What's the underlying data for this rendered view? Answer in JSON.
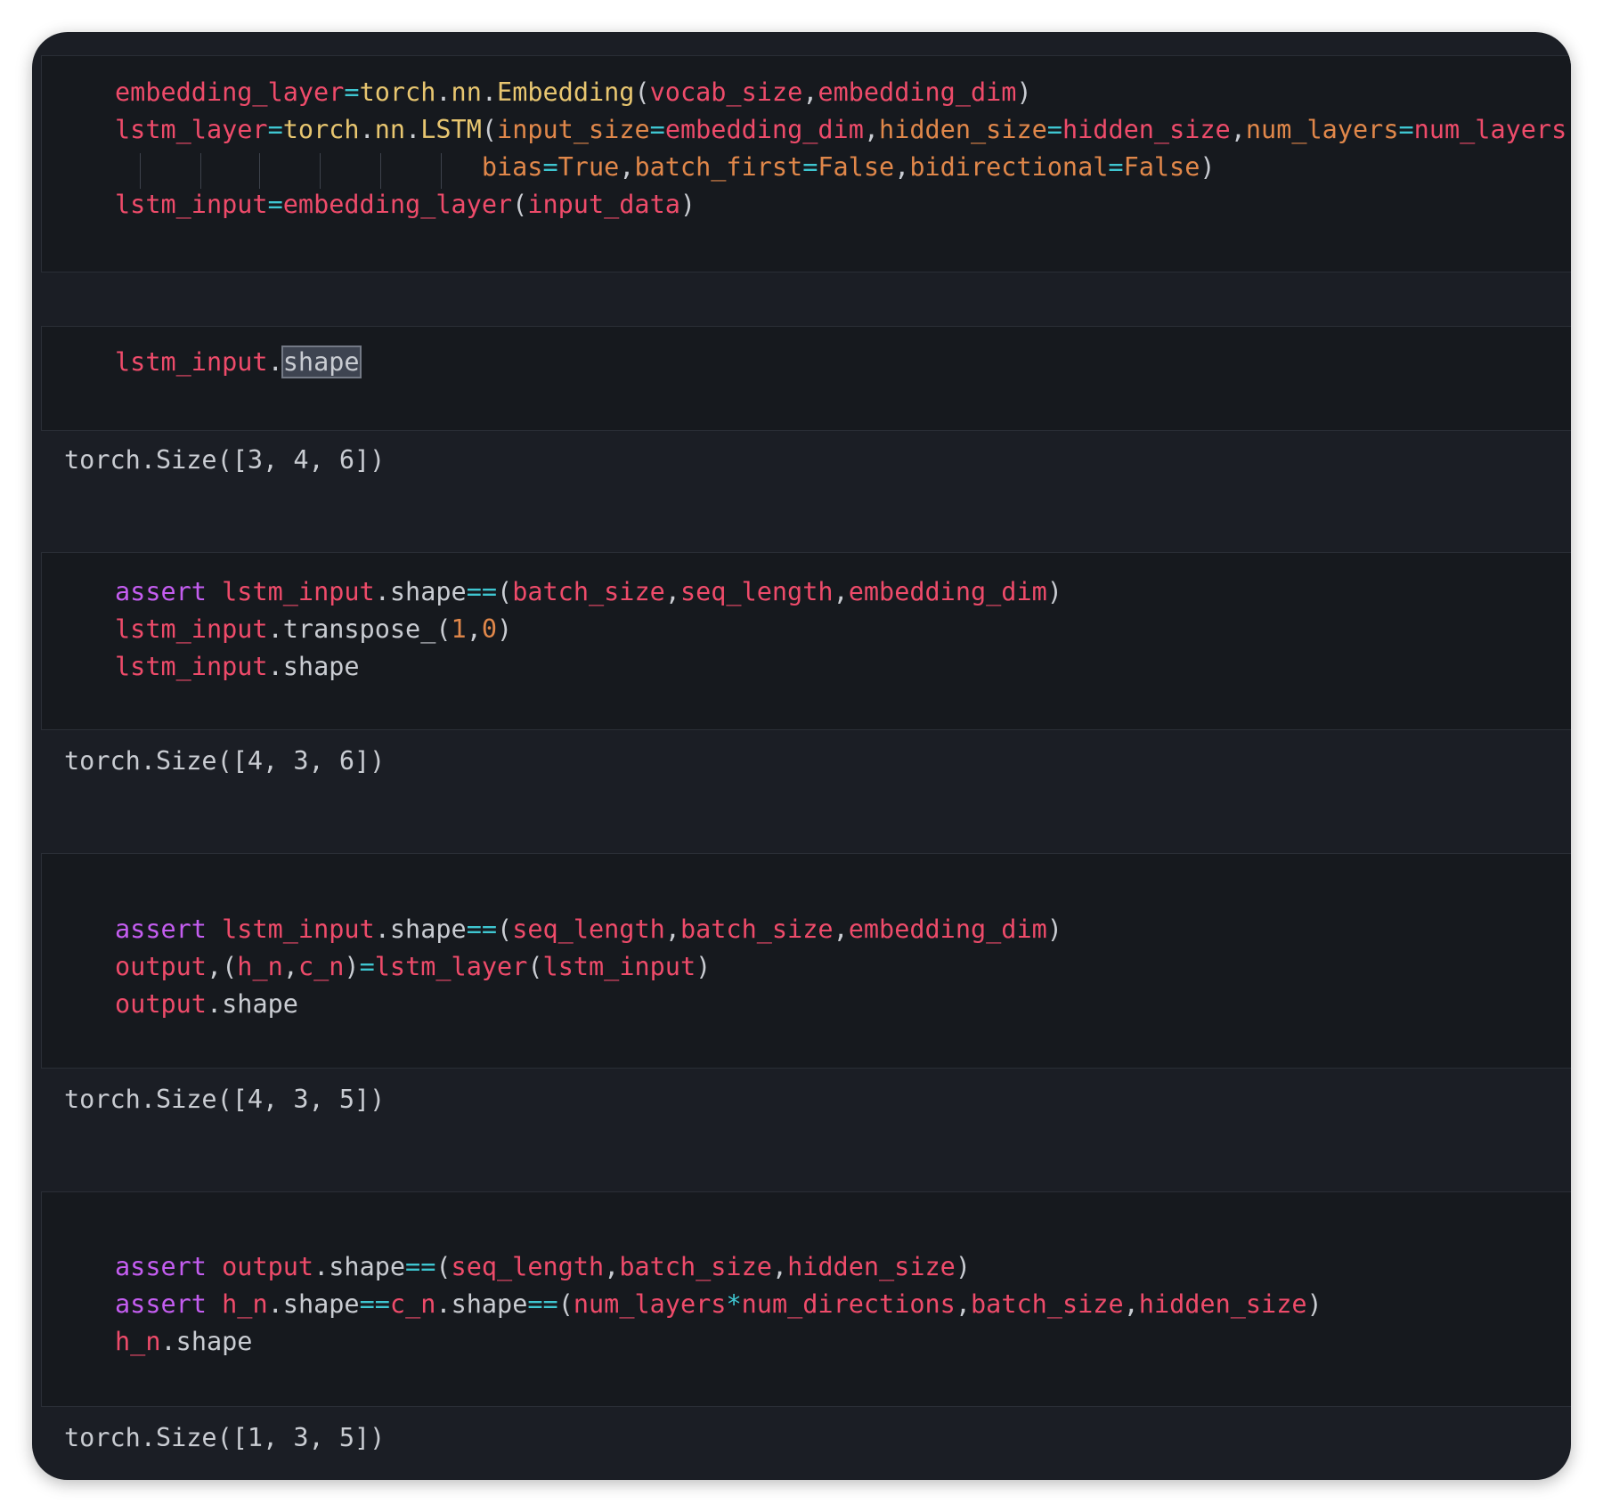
{
  "colors": {
    "background": "#1b1e25",
    "cell_background": "#16191e",
    "variable": "#ee4b6a",
    "keyword": "#c45df0",
    "operator": "#3fc6d1",
    "parameter": "#e0874a",
    "module": "#e8c670",
    "plain": "#c9ccd2",
    "number": "#e0874a"
  },
  "cells": [
    {
      "lines": [
        [
          [
            "embedding_layer",
            "variable"
          ],
          [
            "=",
            "operator"
          ],
          [
            "torch",
            "module"
          ],
          [
            ".",
            "plain"
          ],
          [
            "nn",
            "module"
          ],
          [
            ".",
            "plain"
          ],
          [
            "Embedding",
            "module"
          ],
          [
            "(",
            "plain"
          ],
          [
            "vocab_size",
            "variable"
          ],
          [
            ",",
            "plain"
          ],
          [
            "embedding_dim",
            "variable"
          ],
          [
            ")",
            "plain"
          ]
        ],
        [
          [
            "lstm_layer",
            "variable"
          ],
          [
            "=",
            "operator"
          ],
          [
            "torch",
            "module"
          ],
          [
            ".",
            "plain"
          ],
          [
            "nn",
            "module"
          ],
          [
            ".",
            "plain"
          ],
          [
            "LSTM",
            "module"
          ],
          [
            "(",
            "plain"
          ],
          [
            "input_size",
            "parameter"
          ],
          [
            "=",
            "operator"
          ],
          [
            "embedding_dim",
            "variable"
          ],
          [
            ",",
            "plain"
          ],
          [
            "hidden_size",
            "parameter"
          ],
          [
            "=",
            "operator"
          ],
          [
            "hidden_size",
            "variable"
          ],
          [
            ",",
            "plain"
          ],
          [
            "num_layers",
            "parameter"
          ],
          [
            "=",
            "operator"
          ],
          [
            "num_layers",
            "variable"
          ],
          [
            ",",
            "plain"
          ]
        ],
        [
          [
            "                        ",
            "plain"
          ],
          [
            "bias",
            "parameter"
          ],
          [
            "=",
            "operator"
          ],
          [
            "True",
            "parameter"
          ],
          [
            ",",
            "plain"
          ],
          [
            "batch_first",
            "parameter"
          ],
          [
            "=",
            "operator"
          ],
          [
            "False",
            "parameter"
          ],
          [
            ",",
            "plain"
          ],
          [
            "bidirectional",
            "parameter"
          ],
          [
            "=",
            "operator"
          ],
          [
            "False",
            "parameter"
          ],
          [
            ")",
            "plain"
          ]
        ],
        [
          [
            "lstm_input",
            "variable"
          ],
          [
            "=",
            "operator"
          ],
          [
            "embedding_layer",
            "variable"
          ],
          [
            "(",
            "plain"
          ],
          [
            "input_data",
            "variable"
          ],
          [
            ")",
            "plain"
          ]
        ]
      ],
      "output": ""
    },
    {
      "lines": [
        [
          [
            "lstm_input",
            "variable"
          ],
          [
            ".",
            "plain"
          ],
          [
            "shape",
            "plain"
          ]
        ]
      ],
      "output": "torch.Size([3, 4, 6])"
    },
    {
      "lines": [
        [
          [
            "assert",
            "keyword"
          ],
          [
            " ",
            "plain"
          ],
          [
            "lstm_input",
            "variable"
          ],
          [
            ".",
            "plain"
          ],
          [
            "shape",
            "plain"
          ],
          [
            "==",
            "operator"
          ],
          [
            "(",
            "plain"
          ],
          [
            "batch_size",
            "variable"
          ],
          [
            ",",
            "plain"
          ],
          [
            "seq_length",
            "variable"
          ],
          [
            ",",
            "plain"
          ],
          [
            "embedding_dim",
            "variable"
          ],
          [
            ")",
            "plain"
          ]
        ],
        [
          [
            "lstm_input",
            "variable"
          ],
          [
            ".",
            "plain"
          ],
          [
            "transpose_",
            "plain"
          ],
          [
            "(",
            "plain"
          ],
          [
            "1",
            "number"
          ],
          [
            ",",
            "plain"
          ],
          [
            "0",
            "number"
          ],
          [
            ")",
            "plain"
          ]
        ],
        [
          [
            "lstm_input",
            "variable"
          ],
          [
            ".",
            "plain"
          ],
          [
            "shape",
            "plain"
          ]
        ]
      ],
      "output": "torch.Size([4, 3, 6])"
    },
    {
      "lines": [
        [
          [
            "assert",
            "keyword"
          ],
          [
            " ",
            "plain"
          ],
          [
            "lstm_input",
            "variable"
          ],
          [
            ".",
            "plain"
          ],
          [
            "shape",
            "plain"
          ],
          [
            "==",
            "operator"
          ],
          [
            "(",
            "plain"
          ],
          [
            "seq_length",
            "variable"
          ],
          [
            ",",
            "plain"
          ],
          [
            "batch_size",
            "variable"
          ],
          [
            ",",
            "plain"
          ],
          [
            "embedding_dim",
            "variable"
          ],
          [
            ")",
            "plain"
          ]
        ],
        [
          [
            "output",
            "variable"
          ],
          [
            ",(",
            "plain"
          ],
          [
            "h_n",
            "variable"
          ],
          [
            ",",
            "plain"
          ],
          [
            "c_n",
            "variable"
          ],
          [
            ")",
            "plain"
          ],
          [
            "=",
            "operator"
          ],
          [
            "lstm_layer",
            "variable"
          ],
          [
            "(",
            "plain"
          ],
          [
            "lstm_input",
            "variable"
          ],
          [
            ")",
            "plain"
          ]
        ],
        [
          [
            "output",
            "variable"
          ],
          [
            ".",
            "plain"
          ],
          [
            "shape",
            "plain"
          ]
        ]
      ],
      "output": "torch.Size([4, 3, 5])"
    },
    {
      "lines": [
        [
          [
            "assert",
            "keyword"
          ],
          [
            " ",
            "plain"
          ],
          [
            "output",
            "variable"
          ],
          [
            ".",
            "plain"
          ],
          [
            "shape",
            "plain"
          ],
          [
            "==",
            "operator"
          ],
          [
            "(",
            "plain"
          ],
          [
            "seq_length",
            "variable"
          ],
          [
            ",",
            "plain"
          ],
          [
            "batch_size",
            "variable"
          ],
          [
            ",",
            "plain"
          ],
          [
            "hidden_size",
            "variable"
          ],
          [
            ")",
            "plain"
          ]
        ],
        [
          [
            "assert",
            "keyword"
          ],
          [
            " ",
            "plain"
          ],
          [
            "h_n",
            "variable"
          ],
          [
            ".",
            "plain"
          ],
          [
            "shape",
            "plain"
          ],
          [
            "==",
            "operator"
          ],
          [
            "c_n",
            "variable"
          ],
          [
            ".",
            "plain"
          ],
          [
            "shape",
            "plain"
          ],
          [
            "==",
            "operator"
          ],
          [
            "(",
            "plain"
          ],
          [
            "num_layers",
            "variable"
          ],
          [
            "*",
            "operator"
          ],
          [
            "num_directions",
            "variable"
          ],
          [
            ",",
            "plain"
          ],
          [
            "batch_size",
            "variable"
          ],
          [
            ",",
            "plain"
          ],
          [
            "hidden_size",
            "variable"
          ],
          [
            ")",
            "plain"
          ]
        ],
        [
          [
            "h_n",
            "variable"
          ],
          [
            ".",
            "plain"
          ],
          [
            "shape",
            "plain"
          ]
        ]
      ],
      "output": "torch.Size([1, 3, 5])"
    }
  ]
}
